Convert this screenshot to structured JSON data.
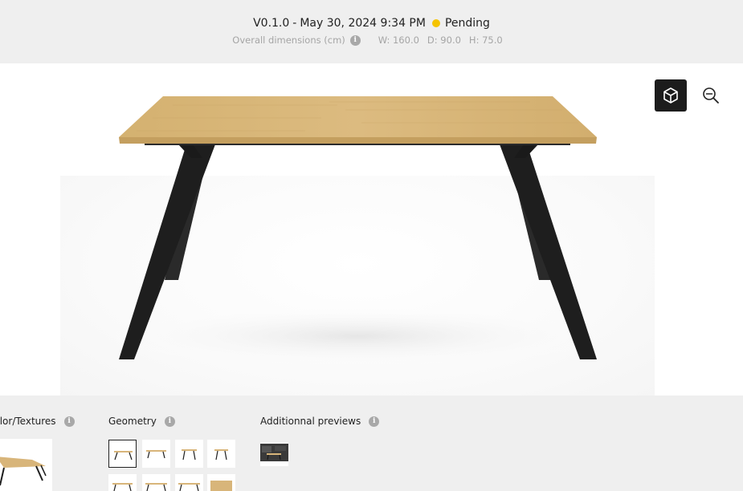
{
  "header": {
    "version": "V0.1.0",
    "separator": "-",
    "datetime": "May 30, 2024 9:34 PM",
    "status": "Pending",
    "status_color": "#f5c400",
    "dimensions_label": "Overall dimensions (cm)",
    "width": "W: 160.0",
    "depth": "D: 90.0",
    "height": "H: 75.0"
  },
  "viewer": {
    "icons": [
      "cube-icon",
      "zoom-out-icon"
    ]
  },
  "panels": {
    "color_textures": {
      "title": "Color/Textures"
    },
    "geometry": {
      "title": "Geometry",
      "options": [
        "geometry-option-1",
        "geometry-option-2",
        "geometry-option-3",
        "geometry-option-4",
        "geometry-option-5",
        "geometry-option-6",
        "geometry-option-7",
        "geometry-option-8"
      ],
      "selected_index": 0
    },
    "additional_previews": {
      "title": "Additionnal previews"
    }
  },
  "colors": {
    "wood": "#d8b57a",
    "leg": "#1e1e1e"
  }
}
